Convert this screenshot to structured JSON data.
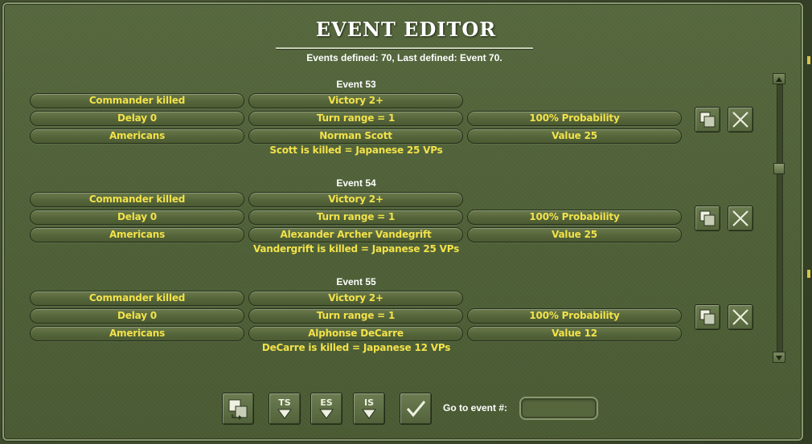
{
  "window": {
    "title": "EVENT EDITOR",
    "subtitle": "Events defined:  70, Last defined: Event  70."
  },
  "events": [
    {
      "title": "Event 53",
      "row1": [
        "Commander killed",
        "Victory 2+"
      ],
      "row2": [
        "Delay 0",
        "Turn range = 1",
        "100% Probability"
      ],
      "row3": [
        "Americans",
        "Norman Scott",
        "Value 25"
      ],
      "description": "Scott is killed = Japanese 25 VPs"
    },
    {
      "title": "Event 54",
      "row1": [
        "Commander killed",
        "Victory 2+"
      ],
      "row2": [
        "Delay 0",
        "Turn range = 1",
        "100% Probability"
      ],
      "row3": [
        "Americans",
        "Alexander Archer Vandegrift",
        "Value 25"
      ],
      "description": "Vandergrift is killed = Japanese 25 VPs"
    },
    {
      "title": "Event 55",
      "row1": [
        "Commander killed",
        "Victory 2+"
      ],
      "row2": [
        "Delay 0",
        "Turn range = 1",
        "100% Probability"
      ],
      "row3": [
        "Americans",
        "Alphonse DeCarre",
        "Value 12"
      ],
      "description": "DeCarre is killed = Japanese 12 VPs"
    }
  ],
  "toolbar": {
    "ts_label": "TS",
    "es_label": "ES",
    "is_label": "IS",
    "goto_label": "Go to event #:",
    "goto_value": ""
  },
  "icons": {
    "copy": "copy-icon",
    "delete": "close-icon",
    "swap": "swap-icon",
    "confirm": "checkmark-icon"
  },
  "colors": {
    "field_text": "#f2e24a",
    "title_text": "#ffffff",
    "panel": "#4f6138"
  }
}
